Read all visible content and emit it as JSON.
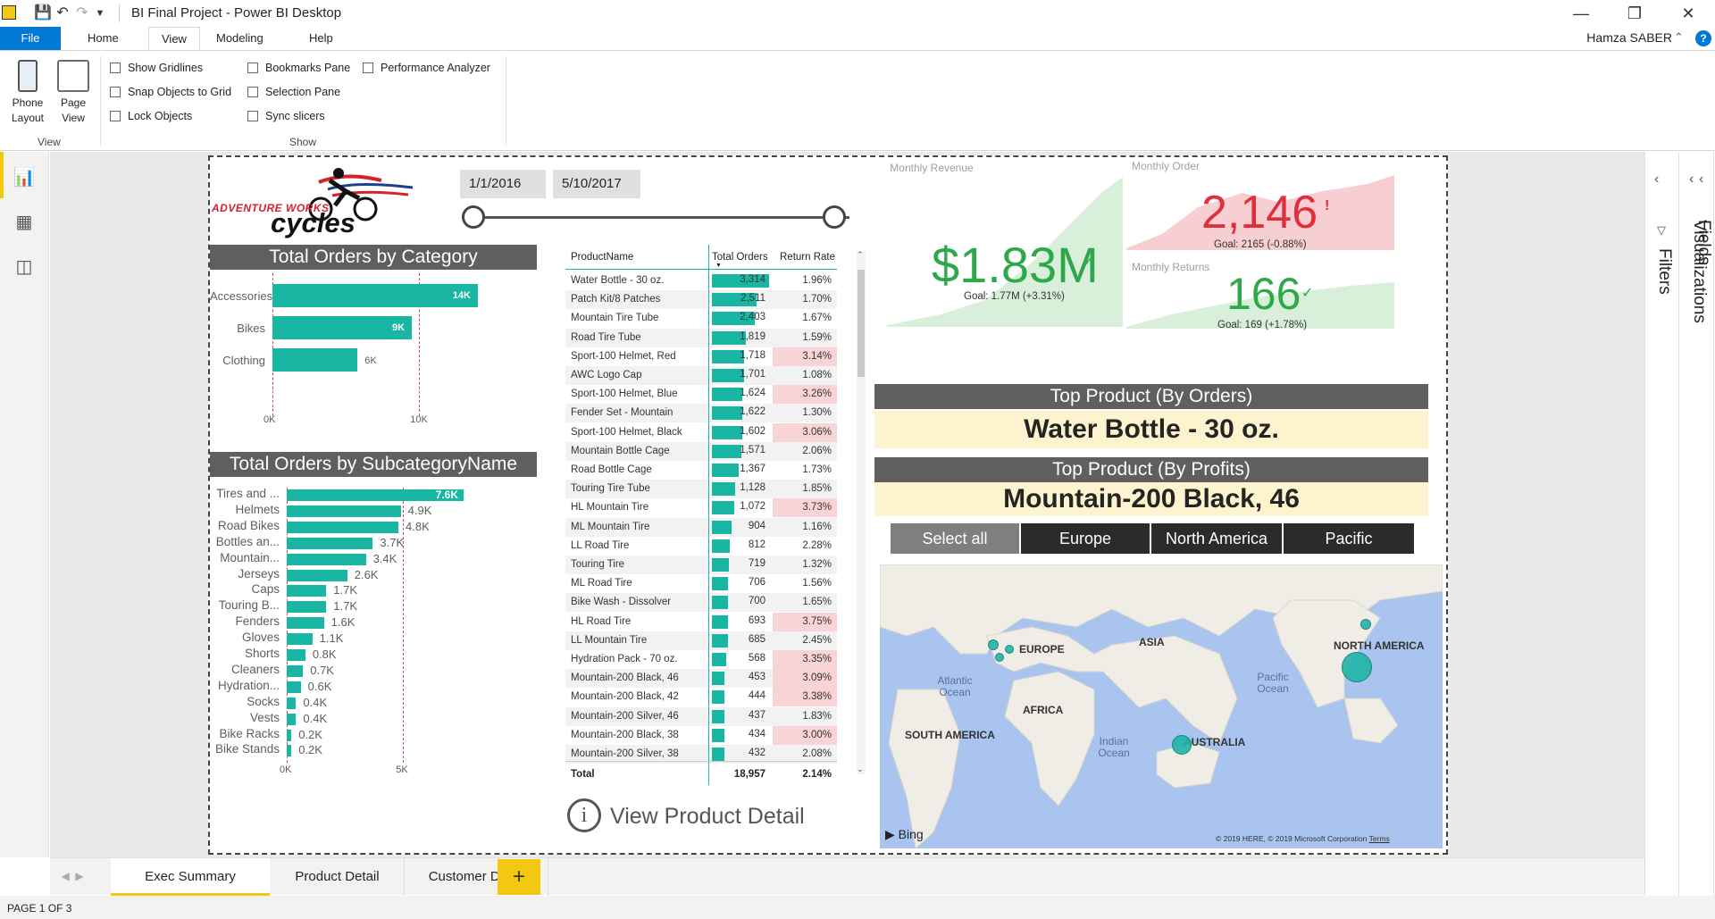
{
  "window": {
    "title": "BI Final Project - Power BI Desktop",
    "user": "Hamza SABER"
  },
  "ribbon_tabs": [
    "File",
    "Home",
    "View",
    "Modeling",
    "Help"
  ],
  "ribbon": {
    "phone_layout": "Phone Layout",
    "page_view": "Page View",
    "group_view": "View",
    "group_show": "Show",
    "checkboxes": {
      "show_gridlines": "Show Gridlines",
      "snap_objects": "Snap Objects to Grid",
      "lock_objects": "Lock Objects",
      "bookmarks_pane": "Bookmarks Pane",
      "selection_pane": "Selection Pane",
      "sync_slicers": "Sync slicers",
      "performance_analyzer": "Performance Analyzer"
    }
  },
  "right_panes": [
    "Filters",
    "Visualizations",
    "Fields"
  ],
  "page_tabs": [
    "Exec Summary",
    "Product Detail",
    "Customer Detail"
  ],
  "status": "PAGE 1 OF 3",
  "logo": {
    "top": "ADVENTURE WORKS",
    "bottom": "cycles"
  },
  "date_slicer": {
    "start": "1/1/2016",
    "end": "5/10/2017"
  },
  "category_chart": {
    "title": "Total Orders by Category",
    "x_ticks": [
      "0K",
      "10K"
    ],
    "xlim": [
      0,
      14000
    ],
    "rows": [
      {
        "label": "Accessories",
        "value": 14000,
        "display": "14K"
      },
      {
        "label": "Bikes",
        "value": 9500,
        "display": "9K"
      },
      {
        "label": "Clothing",
        "value": 5800,
        "display": "6K"
      }
    ]
  },
  "subcat_chart": {
    "title": "Total Orders by SubcategoryName",
    "x_ticks": [
      "0K",
      "5K"
    ],
    "xlim": [
      0,
      7600
    ],
    "rows": [
      {
        "label": "Tires and ...",
        "value": 7600,
        "display": "7.6K"
      },
      {
        "label": "Helmets",
        "value": 4900,
        "display": "4.9K"
      },
      {
        "label": "Road Bikes",
        "value": 4800,
        "display": "4.8K"
      },
      {
        "label": "Bottles an...",
        "value": 3700,
        "display": "3.7K"
      },
      {
        "label": "Mountain...",
        "value": 3400,
        "display": "3.4K"
      },
      {
        "label": "Jerseys",
        "value": 2600,
        "display": "2.6K"
      },
      {
        "label": "Caps",
        "value": 1700,
        "display": "1.7K"
      },
      {
        "label": "Touring B...",
        "value": 1700,
        "display": "1.7K"
      },
      {
        "label": "Fenders",
        "value": 1600,
        "display": "1.6K"
      },
      {
        "label": "Gloves",
        "value": 1100,
        "display": "1.1K"
      },
      {
        "label": "Shorts",
        "value": 800,
        "display": "0.8K"
      },
      {
        "label": "Cleaners",
        "value": 700,
        "display": "0.7K"
      },
      {
        "label": "Hydration...",
        "value": 600,
        "display": "0.6K"
      },
      {
        "label": "Socks",
        "value": 400,
        "display": "0.4K"
      },
      {
        "label": "Vests",
        "value": 400,
        "display": "0.4K"
      },
      {
        "label": "Bike Racks",
        "value": 200,
        "display": "0.2K"
      },
      {
        "label": "Bike Stands",
        "value": 200,
        "display": "0.2K"
      }
    ]
  },
  "product_table": {
    "headers": [
      "ProductName",
      "Total Orders",
      "Return Rate"
    ],
    "rows": [
      [
        "Water Bottle - 30 oz.",
        3314,
        "1.96%"
      ],
      [
        "Patch Kit/8 Patches",
        2511,
        "1.70%"
      ],
      [
        "Mountain Tire Tube",
        2403,
        "1.67%"
      ],
      [
        "Road Tire Tube",
        1819,
        "1.59%"
      ],
      [
        "Sport-100 Helmet, Red",
        1718,
        "3.14%"
      ],
      [
        "AWC Logo Cap",
        1701,
        "1.08%"
      ],
      [
        "Sport-100 Helmet, Blue",
        1624,
        "3.26%"
      ],
      [
        "Fender Set - Mountain",
        1622,
        "1.30%"
      ],
      [
        "Sport-100 Helmet, Black",
        1602,
        "3.06%"
      ],
      [
        "Mountain Bottle Cage",
        1571,
        "2.06%"
      ],
      [
        "Road Bottle Cage",
        1367,
        "1.73%"
      ],
      [
        "Touring Tire Tube",
        1128,
        "1.85%"
      ],
      [
        "HL Mountain Tire",
        1072,
        "3.73%"
      ],
      [
        "ML Mountain Tire",
        904,
        "1.16%"
      ],
      [
        "LL Road Tire",
        812,
        "2.28%"
      ],
      [
        "Touring Tire",
        719,
        "1.32%"
      ],
      [
        "ML Road Tire",
        706,
        "1.56%"
      ],
      [
        "Bike Wash - Dissolver",
        700,
        "1.65%"
      ],
      [
        "HL Road Tire",
        693,
        "3.75%"
      ],
      [
        "LL Mountain Tire",
        685,
        "2.45%"
      ],
      [
        "Hydration Pack - 70 oz.",
        568,
        "3.35%"
      ],
      [
        "Mountain-200 Black, 46",
        453,
        "3.09%"
      ],
      [
        "Mountain-200 Black, 42",
        444,
        "3.38%"
      ],
      [
        "Mountain-200 Silver, 46",
        437,
        "1.83%"
      ],
      [
        "Mountain-200 Black, 38",
        434,
        "3.00%"
      ],
      [
        "Mountain-200 Silver, 38",
        432,
        "2.08%"
      ]
    ],
    "total_label": "Total",
    "total_orders": "18,957",
    "total_rate": "2.14%"
  },
  "view_detail": "View Product Detail",
  "kpi_revenue": {
    "title": "Monthly Revenue",
    "value": "$1.83M",
    "goal": "Goal: 1.77M (+3.31%)"
  },
  "kpi_orders": {
    "title": "Monthly Order",
    "value": "2,146",
    "goal": "Goal: 2165 (-0.88%)"
  },
  "kpi_returns": {
    "title": "Monthly Returns",
    "value": "166",
    "goal": "Goal: 169 (+1.78%)"
  },
  "top_orders": {
    "title": "Top Product (By Orders)",
    "value": "Water Bottle - 30 oz."
  },
  "top_profits": {
    "title": "Top Product (By Profits)",
    "value": "Mountain-200 Black, 46"
  },
  "region_slicer": [
    "Select all",
    "Europe",
    "North America",
    "Pacific"
  ],
  "map": {
    "labels": [
      "EUROPE",
      "ASIA",
      "NORTH AMERICA",
      "AFRICA",
      "SOUTH AMERICA",
      "AUSTRALIA"
    ],
    "oceans": [
      "Atlantic Ocean",
      "Pacific Ocean",
      "Indian Ocean"
    ],
    "bing": "Bing",
    "copyright": "© 2019 HERE, © 2019 Microsoft Corporation",
    "terms": "Terms"
  },
  "colors": {
    "accent": "#19b6a4",
    "kpi_green": "#2ea84b",
    "kpi_red": "#e02e3b",
    "title_bg": "#5f5f5f",
    "highlight": "#fdf3cf"
  }
}
